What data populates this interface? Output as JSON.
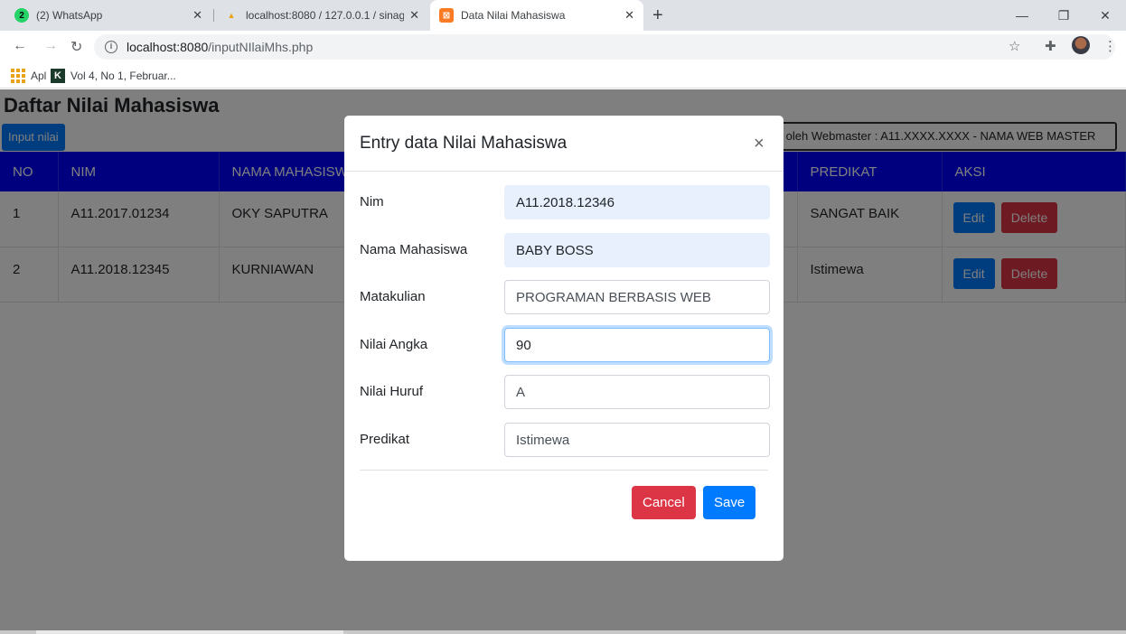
{
  "browser": {
    "tabs": [
      {
        "label": "(2) WhatsApp",
        "favicon": "2"
      },
      {
        "label": "localhost:8080 / 127.0.0.1 / sinag",
        "favicon": "pma"
      },
      {
        "label": "Data Nilai Mahasiswa",
        "favicon": "xampp"
      }
    ],
    "url_host": "localhost:8080",
    "url_path": "/inputNIlaiMhs.php",
    "bookmarks": [
      {
        "label": "Apl"
      },
      {
        "label": "Vol 4, No 1, Februar..."
      }
    ]
  },
  "page": {
    "title": "Daftar Nilai Mahasiswa",
    "input_button": "Input nilai",
    "credit": "uat oleh Webmaster : A11.XXXX.XXXX - NAMA WEB MASTER",
    "table": {
      "headers": [
        "NO",
        "NIM",
        "NAMA MAHASISWA",
        "",
        "",
        "PREDIKAT",
        "AKSI"
      ],
      "rows": [
        {
          "no": "1",
          "nim": "A11.2017.01234",
          "nama": "OKY SAPUTRA",
          "predikat": "SANGAT BAIK"
        },
        {
          "no": "2",
          "nim": "A11.2018.12345",
          "nama": "KURNIAWAN",
          "predikat": "Istimewa"
        }
      ],
      "edit_label": "Edit",
      "delete_label": "Delete"
    }
  },
  "modal": {
    "title": "Entry data Nilai Mahasiswa",
    "close": "×",
    "fields": [
      {
        "label": "Nim",
        "value": "A11.2018.12346"
      },
      {
        "label": "Nama Mahasiswa",
        "value": "BABY BOSS"
      },
      {
        "label": "Matakulian",
        "value": "PROGRAMAN BERBASIS WEB"
      },
      {
        "label": "Nilai Angka",
        "value": "90"
      },
      {
        "label": "Nilai Huruf",
        "value": "A"
      },
      {
        "label": "Predikat",
        "value": "Istimewa"
      }
    ],
    "cancel": "Cancel",
    "save": "Save"
  },
  "colors": {
    "primary": "#007bff",
    "danger": "#dc3545",
    "table_header": "#0000ff"
  }
}
